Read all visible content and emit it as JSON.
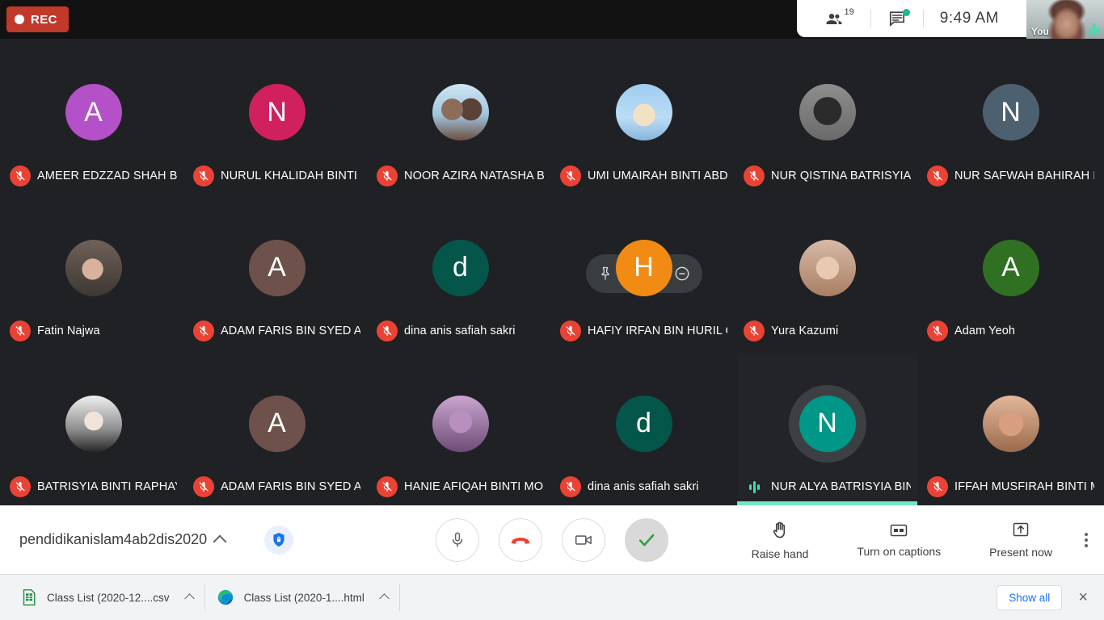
{
  "topbar": {
    "rec_label": "REC",
    "participant_count": "19",
    "time": "9:49 AM",
    "self_label": "You"
  },
  "grid": {
    "tiles": [
      {
        "name": "AMEER EDZZAD SHAH BI...",
        "avatar_type": "letter",
        "letter": "A",
        "color": "#b450c8",
        "muted": true,
        "speaking": false,
        "hovered": false
      },
      {
        "name": "NURUL KHALIDAH BINTI ...",
        "avatar_type": "letter",
        "letter": "N",
        "color": "#d0215e",
        "muted": true,
        "speaking": false,
        "hovered": false
      },
      {
        "name": "NOOR AZIRA NATASHA BI...",
        "avatar_type": "photo",
        "letter": "",
        "color": "#8fb8d6",
        "muted": true,
        "speaking": false,
        "hovered": false
      },
      {
        "name": "UMI UMAIRAH BINTI ABD ...",
        "avatar_type": "photo",
        "letter": "",
        "color": "#7fb2e5",
        "muted": true,
        "speaking": false,
        "hovered": false
      },
      {
        "name": "NUR QISTINA BATRISYIA B...",
        "avatar_type": "photo",
        "letter": "",
        "color": "#6b6b6b",
        "muted": true,
        "speaking": false,
        "hovered": false
      },
      {
        "name": "NUR SAFWAH BAHIRAH BI...",
        "avatar_type": "letter",
        "letter": "N",
        "color": "#4d6070",
        "muted": true,
        "speaking": false,
        "hovered": false
      },
      {
        "name": "Fatin Najwa",
        "avatar_type": "photo",
        "letter": "",
        "color": "#7d6a66",
        "muted": true,
        "speaking": false,
        "hovered": false
      },
      {
        "name": "ADAM FARIS BIN SYED ALI...",
        "avatar_type": "letter",
        "letter": "A",
        "color": "#6d514a",
        "muted": true,
        "speaking": false,
        "hovered": false
      },
      {
        "name": "dina anis safiah sakri",
        "avatar_type": "letter",
        "letter": "d",
        "color": "#04564a",
        "muted": true,
        "speaking": false,
        "hovered": false
      },
      {
        "name": "HAFIY IRFAN BIN HURIL Q...",
        "avatar_type": "letter",
        "letter": "H",
        "color": "#f28b14",
        "muted": true,
        "speaking": false,
        "hovered": true
      },
      {
        "name": "Yura Kazumi",
        "avatar_type": "photo",
        "letter": "",
        "color": "#c9a58f",
        "muted": true,
        "speaking": false,
        "hovered": false
      },
      {
        "name": "Adam Yeoh",
        "avatar_type": "letter",
        "letter": "A",
        "color": "#2f7022",
        "muted": true,
        "speaking": false,
        "hovered": false
      },
      {
        "name": "BATRISYIA BINTI RAPHAY ...",
        "avatar_type": "photo",
        "letter": "",
        "color": "#9aa0a6",
        "muted": true,
        "speaking": false,
        "hovered": false
      },
      {
        "name": "ADAM FARIS BIN SYED ALI...",
        "avatar_type": "letter",
        "letter": "A",
        "color": "#6d514a",
        "muted": true,
        "speaking": false,
        "hovered": false
      },
      {
        "name": "HANIE AFIQAH BINTI MO...",
        "avatar_type": "photo",
        "letter": "",
        "color": "#7a5f8a",
        "muted": true,
        "speaking": false,
        "hovered": false
      },
      {
        "name": "dina anis safiah sakri",
        "avatar_type": "letter",
        "letter": "d",
        "color": "#04564a",
        "muted": true,
        "speaking": false,
        "hovered": false
      },
      {
        "name": "NUR ALYA BATRISYIA BIN...",
        "avatar_type": "letter",
        "letter": "N",
        "color": "#009688",
        "muted": false,
        "speaking": true,
        "hovered": false
      },
      {
        "name": "IFFAH MUSFIRAH BINTI M...",
        "avatar_type": "photo",
        "letter": "",
        "color": "#c08f74",
        "muted": true,
        "speaking": false,
        "hovered": false
      }
    ]
  },
  "controls": {
    "meeting_code": "pendidikanislam4ab2dis2020",
    "raise_hand": "Raise hand",
    "captions": "Turn on captions",
    "present": "Present now"
  },
  "downloads": {
    "items": [
      {
        "label": "Class List (2020-12....csv",
        "icon": "csv-file-icon"
      },
      {
        "label": "Class List (2020-1....html",
        "icon": "edge-browser-icon"
      }
    ],
    "show_all": "Show all",
    "close": "×"
  },
  "colors": {
    "rec_red": "#c0392b",
    "mute_red": "#ea4335",
    "speaking_teal": "#6fe8c3",
    "link_blue": "#1a73e8"
  }
}
